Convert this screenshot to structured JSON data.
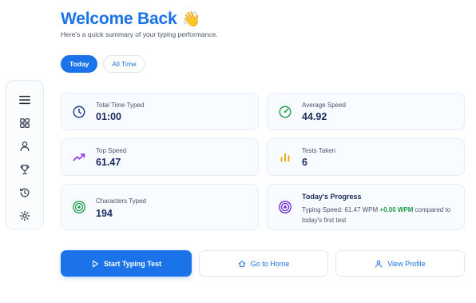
{
  "header": {
    "title": "Welcome Back",
    "wave_emoji": "👋",
    "subtitle": "Here's a quick summary of your typing performance."
  },
  "tabs": [
    {
      "label": "Today",
      "active": true
    },
    {
      "label": "All Time",
      "active": false
    }
  ],
  "sidebar": {
    "items": [
      {
        "icon": "hamburger-menu-icon"
      },
      {
        "icon": "dashboard-grid-icon"
      },
      {
        "icon": "user-icon"
      },
      {
        "icon": "trophy-icon"
      },
      {
        "icon": "history-icon"
      },
      {
        "icon": "gear-icon"
      }
    ]
  },
  "stats": {
    "total_time": {
      "label": "Total Time Typed",
      "value": "01:00",
      "icon": "clock-icon"
    },
    "avg_speed": {
      "label": "Average Speed",
      "value": "44.92",
      "icon": "speedometer-icon"
    },
    "top_speed": {
      "label": "Top Speed",
      "value": "61.47",
      "icon": "trending-up-icon"
    },
    "tests_taken": {
      "label": "Tests Taken",
      "value": "6",
      "icon": "bar-chart-icon"
    },
    "characters": {
      "label": "Characters Typed",
      "value": "194",
      "icon": "target-icon"
    }
  },
  "progress": {
    "title": "Today's Progress",
    "text_prefix": "Typing Speed: 61.47 WPM",
    "delta": "+0.00 WPM",
    "text_suffix": "compared to today's first test",
    "icon": "target-icon"
  },
  "actions": {
    "start": {
      "label": "Start Typing Test",
      "icon": "play-icon"
    },
    "home": {
      "label": "Go to Home",
      "icon": "home-icon"
    },
    "profile": {
      "label": "View Profile",
      "icon": "user-icon"
    }
  },
  "colors": {
    "accent": "#1a73e8",
    "positive": "#1e9e48",
    "value_text": "#1a2b5e"
  }
}
